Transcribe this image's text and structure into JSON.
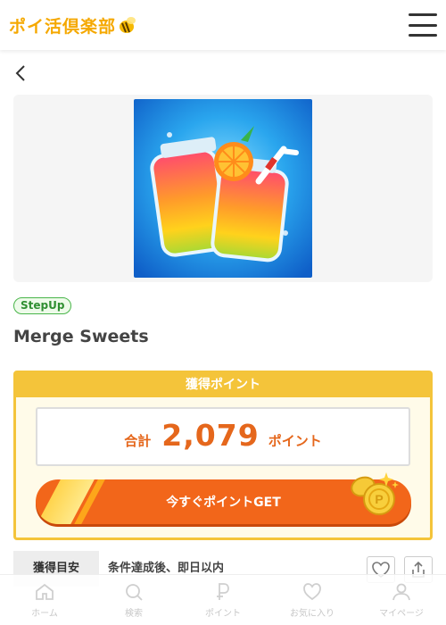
{
  "header": {
    "logo_text": "ポイ活倶楽部",
    "logo_icon": "bee-icon",
    "menu_icon": "hamburger-menu-icon"
  },
  "nav": {
    "back_icon": "chevron-left-icon"
  },
  "offer": {
    "image": "merge-sweets-app-icon",
    "badge": "StepUp",
    "title": "Merge Sweets"
  },
  "points": {
    "header": "獲得ポイント",
    "total_label": "合計",
    "total_value": "2,079",
    "unit": "ポイント",
    "cta_label": "今すぐポイントGET"
  },
  "timing": {
    "tab_label": "獲得目安",
    "text": "条件達成後、即日以内"
  },
  "actions": {
    "favorite_icon": "heart-icon",
    "share_icon": "share-icon"
  },
  "tabbar": {
    "items": [
      {
        "label": "ホーム",
        "icon": "home-icon"
      },
      {
        "label": "検索",
        "icon": "search-icon"
      },
      {
        "label": "ポイント",
        "icon": "point-icon"
      },
      {
        "label": "お気に入り",
        "icon": "heart-icon"
      },
      {
        "label": "マイページ",
        "icon": "user-icon"
      }
    ]
  },
  "colors": {
    "brand": "#f5a800",
    "accent": "#f2661a",
    "card_border": "#f4c43a",
    "badge": "#49b54a"
  }
}
